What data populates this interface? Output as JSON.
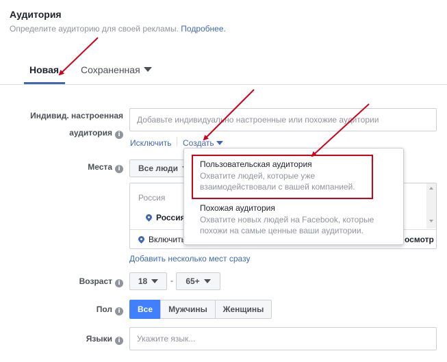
{
  "header": {
    "title": "Аудитория",
    "subtitle": "Определите аудиторию для своей рекламы.",
    "learn_more": "Подробнее."
  },
  "tabs": [
    {
      "label": "Новая",
      "active": true
    },
    {
      "label": "Сохраненная",
      "active": false
    }
  ],
  "custom_audience": {
    "label_line1": "Индивид. настроенная",
    "label_line2": "аудитория",
    "placeholder": "Добавьте индивидуально настроенные или похожие аудитории",
    "exclude_link": "Исключить",
    "create_link": "Создать"
  },
  "create_menu": {
    "items": [
      {
        "title": "Пользовательская аудитория",
        "desc_line1": "Охватите людей, которые уже",
        "desc_line2": "взаимодействовали с вашей компанией."
      },
      {
        "title": "Похожая аудитория",
        "desc_line1": "Охватите новых людей на Facebook, которые",
        "desc_line2": "похожи на самые ценные ваши аудитории."
      }
    ]
  },
  "places": {
    "label": "Места",
    "dropdown_value": "Все люди",
    "list_header": "Россия",
    "list_item": "Россия",
    "include_text": "Включить",
    "browse_text": "осмотр",
    "add_multiple_link": "Добавить несколько мест сразу"
  },
  "age": {
    "label": "Возраст",
    "min": "18",
    "separator": "-",
    "max": "65+"
  },
  "gender": {
    "label": "Пол",
    "options": [
      "Все",
      "Мужчины",
      "Женщины"
    ],
    "selected": "Все"
  },
  "languages": {
    "label": "Языки",
    "placeholder": "Укажите язык..."
  },
  "colors": {
    "accent": "#4267b2",
    "active_button": "#4080ff",
    "annotation": "#d0021b"
  }
}
